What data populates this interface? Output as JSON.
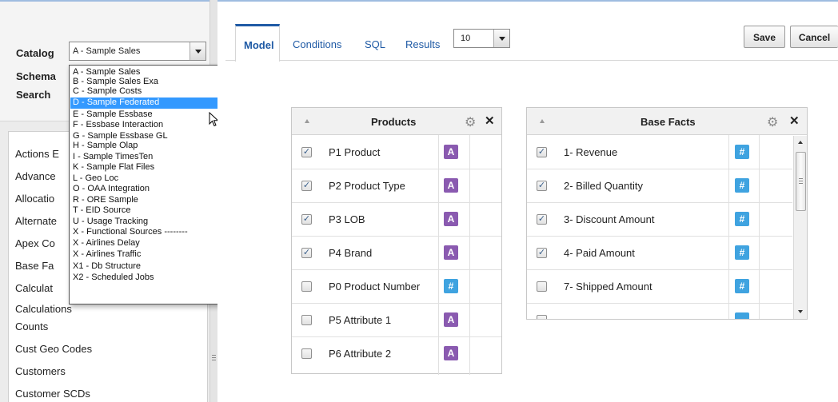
{
  "catalog": {
    "label": "Catalog",
    "value": "A - Sample Sales",
    "options": [
      "A - Sample Sales",
      "B - Sample Sales Exa",
      "C - Sample Costs",
      "D - Sample Federated",
      "E - Sample Essbase",
      "F - Essbase Interaction",
      "G - Sample Essbase GL",
      "H - Sample Olap",
      "I - Sample TimesTen",
      "K - Sample Flat Files",
      "L - Geo Loc",
      "O - OAA Integration",
      "R - ORE Sample",
      "T - EID Source",
      "U - Usage Tracking",
      "X - Functional Sources --------",
      "X - Airlines Delay",
      "X - Airlines Traffic",
      "X1 - Db Structure",
      "X2 - Scheduled Jobs"
    ],
    "highlighted": "D - Sample Federated"
  },
  "schema": {
    "label": "Schema"
  },
  "search": {
    "label": "Search"
  },
  "subject_areas": [
    "Actions E",
    "Advance",
    "Allocatio",
    "Alternate",
    "Apex Co",
    "Base Fa",
    "Calculat",
    "Calculations",
    "Counts",
    "Cust Geo Codes",
    "Customers",
    "Customer SCDs"
  ],
  "tabs": {
    "model": "Model",
    "conditions": "Conditions",
    "sql": "SQL",
    "results": "Results"
  },
  "rows": {
    "value": "10"
  },
  "buttons": {
    "save": "Save",
    "cancel": "Cancel"
  },
  "products": {
    "title": "Products",
    "rows": [
      {
        "name": "P1 Product",
        "checked": true,
        "type": "A"
      },
      {
        "name": "P2 Product Type",
        "checked": true,
        "type": "A"
      },
      {
        "name": "P3 LOB",
        "checked": true,
        "type": "A"
      },
      {
        "name": "P4 Brand",
        "checked": true,
        "type": "A"
      },
      {
        "name": "P0 Product Number",
        "checked": false,
        "type": "#"
      },
      {
        "name": "P5 Attribute 1",
        "checked": false,
        "type": "A"
      },
      {
        "name": "P6 Attribute 2",
        "checked": false,
        "type": "A"
      }
    ]
  },
  "base_facts": {
    "title": "Base Facts",
    "rows": [
      {
        "name": "1- Revenue",
        "checked": true,
        "type": "#"
      },
      {
        "name": "2- Billed Quantity",
        "checked": true,
        "type": "#"
      },
      {
        "name": "3- Discount Amount",
        "checked": true,
        "type": "#"
      },
      {
        "name": "4- Paid Amount",
        "checked": true,
        "type": "#"
      },
      {
        "name": "7- Shipped Amount",
        "checked": false,
        "type": "#"
      }
    ]
  },
  "colors": {
    "accent": "#1f5aa5",
    "attribute_icon": "#8a5ab0",
    "measure_icon": "#3fa3e0",
    "selection": "#3399ff"
  }
}
